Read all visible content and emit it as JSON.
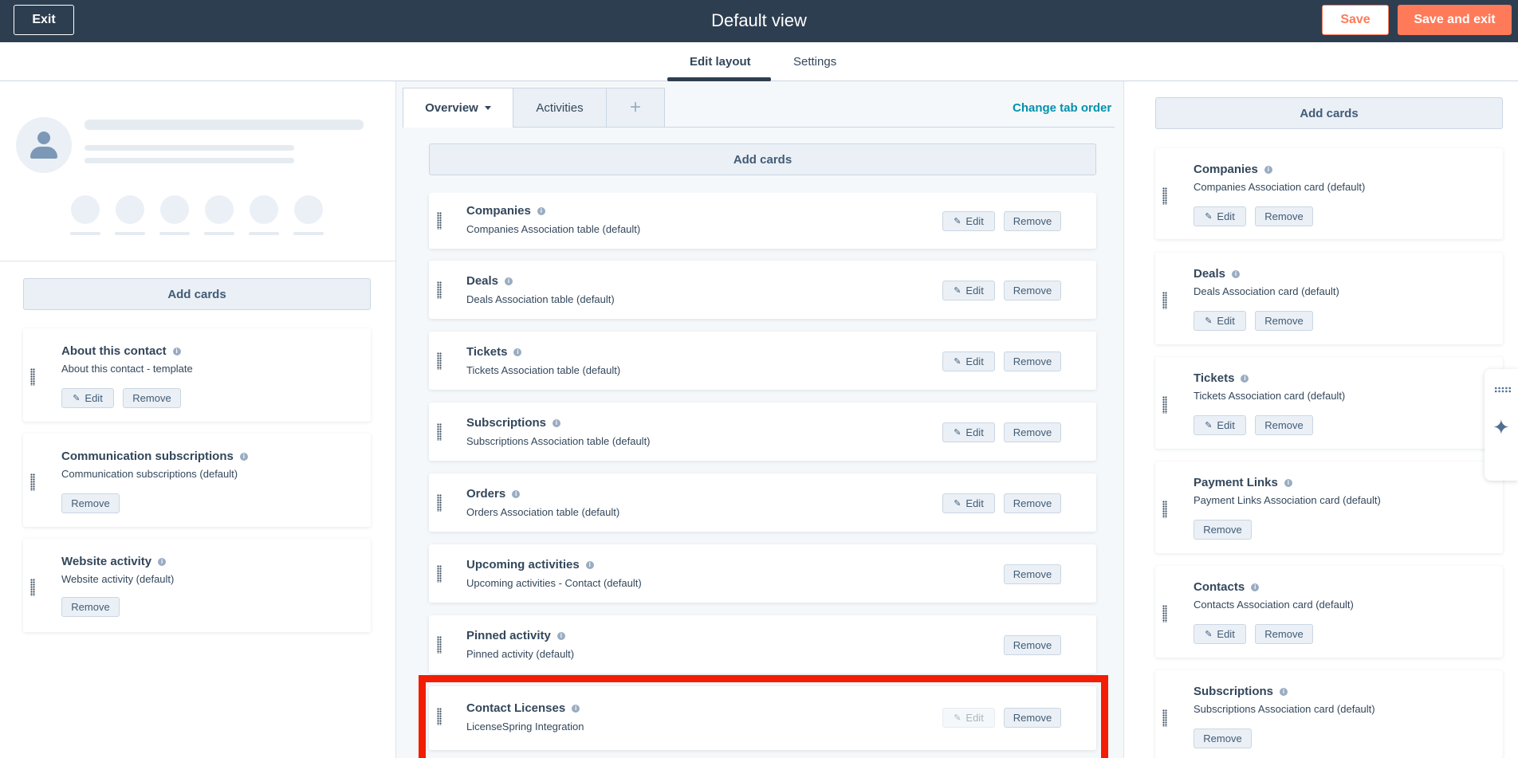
{
  "topbar": {
    "exit_label": "Exit",
    "title": "Default view",
    "save_label": "Save",
    "save_exit_label": "Save and exit"
  },
  "tabs": {
    "edit_layout": "Edit layout",
    "settings": "Settings"
  },
  "left": {
    "add_cards": "Add cards",
    "cards": [
      {
        "title": "About this contact",
        "sub": "About this contact - template",
        "edit": "Edit",
        "remove": "Remove"
      },
      {
        "title": "Communication subscriptions",
        "sub": "Communication subscriptions (default)",
        "remove": "Remove"
      },
      {
        "title": "Website activity",
        "sub": "Website activity (default)",
        "remove": "Remove"
      }
    ]
  },
  "middle": {
    "tabs": [
      "Overview",
      "Activities",
      "+"
    ],
    "change_tab_order": "Change tab order",
    "add_cards": "Add cards",
    "cards": [
      {
        "title": "Companies",
        "sub": "Companies Association table (default)",
        "edit": "Edit",
        "remove": "Remove"
      },
      {
        "title": "Deals",
        "sub": "Deals Association table (default)",
        "edit": "Edit",
        "remove": "Remove"
      },
      {
        "title": "Tickets",
        "sub": "Tickets Association table (default)",
        "edit": "Edit",
        "remove": "Remove"
      },
      {
        "title": "Subscriptions",
        "sub": "Subscriptions Association table (default)",
        "edit": "Edit",
        "remove": "Remove"
      },
      {
        "title": "Orders",
        "sub": "Orders Association table (default)",
        "edit": "Edit",
        "remove": "Remove"
      },
      {
        "title": "Upcoming activities",
        "sub": "Upcoming activities - Contact (default)",
        "remove": "Remove"
      },
      {
        "title": "Pinned activity",
        "sub": "Pinned activity (default)",
        "remove": "Remove"
      },
      {
        "title": "Contact Licenses",
        "sub": "LicenseSpring Integration",
        "edit": "Edit",
        "remove": "Remove"
      }
    ]
  },
  "right": {
    "add_cards": "Add cards",
    "cards": [
      {
        "title": "Companies",
        "sub": "Companies Association card (default)",
        "edit": "Edit",
        "remove": "Remove"
      },
      {
        "title": "Deals",
        "sub": "Deals Association card (default)",
        "edit": "Edit",
        "remove": "Remove"
      },
      {
        "title": "Tickets",
        "sub": "Tickets Association card (default)",
        "edit": "Edit",
        "remove": "Remove"
      },
      {
        "title": "Payment Links",
        "sub": "Payment Links Association card (default)",
        "remove": "Remove"
      },
      {
        "title": "Contacts",
        "sub": "Contacts Association card (default)",
        "edit": "Edit",
        "remove": "Remove"
      },
      {
        "title": "Subscriptions",
        "sub": "Subscriptions Association card (default)",
        "remove": "Remove"
      }
    ]
  },
  "icons": {
    "info": "i",
    "pencil": "✎",
    "sparkle": "✦"
  },
  "colors": {
    "topbar_bg": "#2d3e50",
    "accent_orange": "#ff7a59",
    "link_teal": "#0091ae",
    "highlight_red": "#f21d04"
  }
}
